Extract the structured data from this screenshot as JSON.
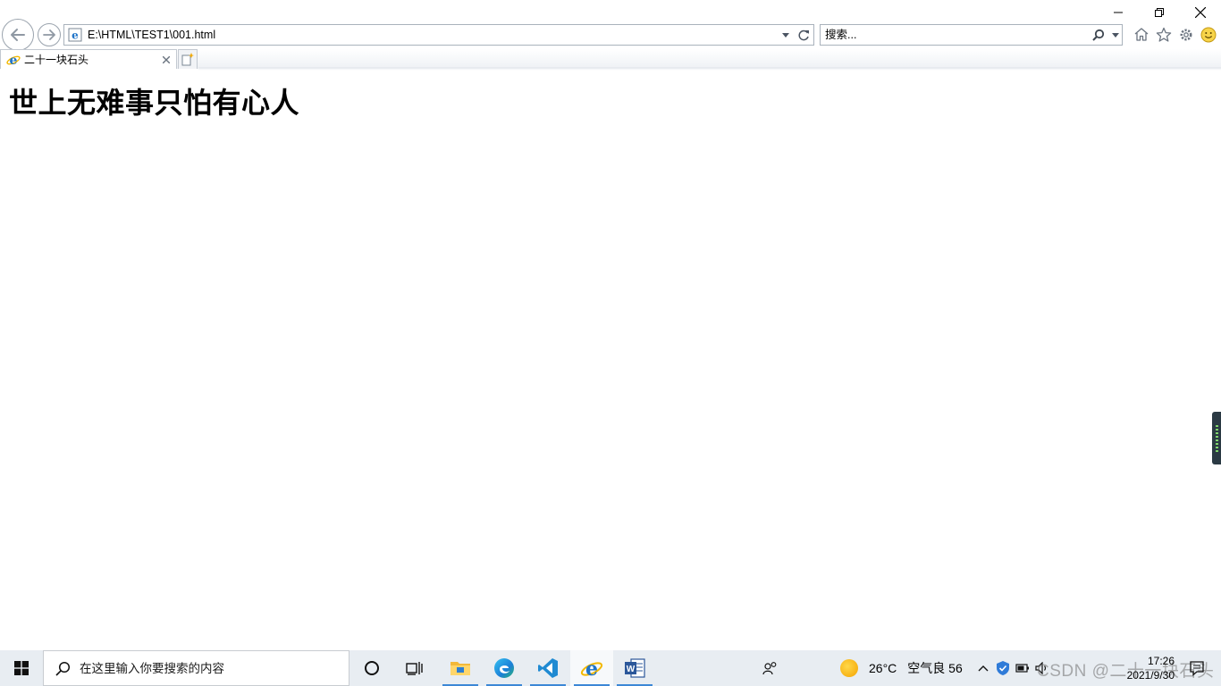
{
  "window": {
    "controls": [
      "minimize",
      "restore",
      "close"
    ]
  },
  "browser": {
    "address": "E:\\HTML\\TEST1\\001.html",
    "search_placeholder": "搜索...",
    "toolbar_icons": [
      "home-icon",
      "favorites-star-icon",
      "settings-gear-icon",
      "feedback-smiley-icon"
    ],
    "tabs": [
      {
        "title": "二十一块石头",
        "active": true
      }
    ]
  },
  "page": {
    "heading": "世上无难事只怕有心人"
  },
  "taskbar": {
    "search_placeholder": "在这里输入你要搜索的内容",
    "apps": [
      "file-explorer-icon",
      "edge-icon",
      "vscode-icon",
      "internet-explorer-icon",
      "word-icon"
    ],
    "weather": {
      "temperature": "26°C",
      "air_quality": "空气良 56"
    },
    "watermark": "CSDN @二十一块石头",
    "clock": {
      "time": "17:26",
      "date": "2021/9/30"
    }
  },
  "colors": {
    "taskbar_bg": "#e8edf2",
    "accent": "#3c87d6",
    "ie_blue": "#1e73c8"
  }
}
